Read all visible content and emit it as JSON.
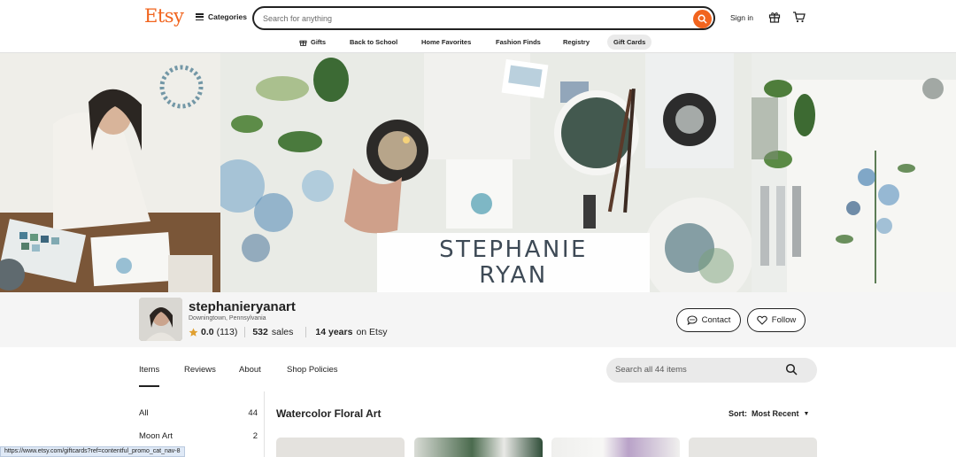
{
  "header": {
    "logo": "Etsy",
    "categories_label": "Categories",
    "search_placeholder": "Search for anything",
    "signin_label": "Sign in"
  },
  "subnav": [
    {
      "label": "Gifts",
      "icon": "gift-icon"
    },
    {
      "label": "Back to School"
    },
    {
      "label": "Home Favorites"
    },
    {
      "label": "Fashion Finds"
    },
    {
      "label": "Registry"
    },
    {
      "label": "Gift Cards",
      "active": true
    }
  ],
  "banner": {
    "title_line1": "STEPHANIE",
    "title_line2": "RYAN"
  },
  "shop": {
    "name": "stephanieryanart",
    "location": "Downingtown, Pennsylvania",
    "rating": "0.0",
    "reviews_count": "(113)",
    "sales_count": "532",
    "sales_label": "sales",
    "years": "14 years",
    "years_suffix": "on Etsy",
    "contact_label": "Contact",
    "follow_label": "Follow"
  },
  "tabs": [
    {
      "label": "Items",
      "active": true
    },
    {
      "label": "Reviews"
    },
    {
      "label": "About"
    },
    {
      "label": "Shop Policies"
    }
  ],
  "shop_search_placeholder": "Search all 44 items",
  "sidebar": [
    {
      "label": "All",
      "count": "44"
    },
    {
      "label": "Moon Art",
      "count": "2"
    }
  ],
  "section": {
    "title": "Watercolor Floral Art",
    "sort_prefix": "Sort:",
    "sort_value": "Most Recent"
  },
  "status_url": "https://www.etsy.com/giftcards?ref=contentful_promo_cat_nav-8",
  "colors": {
    "brand": "#f1641e",
    "text": "#222222",
    "star": "#e0a030"
  }
}
